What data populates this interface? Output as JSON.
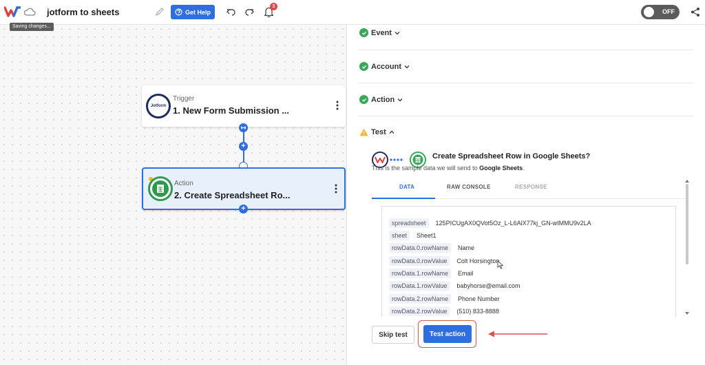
{
  "header": {
    "flow_title": "jotform to sheets",
    "saving_tooltip": "Saving changes...",
    "help_label": "Get Help",
    "notification_count": "3",
    "toggle_label": "OFF"
  },
  "canvas": {
    "trigger": {
      "subtitle": "Trigger",
      "title": "1. New Form Submission ...",
      "app_logo_text": "Jotform"
    },
    "action": {
      "subtitle": "Action",
      "title": "2. Create Spreadsheet Ro..."
    }
  },
  "panel": {
    "sections": {
      "event": "Event",
      "account": "Account",
      "action": "Action",
      "test": "Test"
    },
    "test_summary": {
      "title": "Create Spreadsheet Row in Google Sheets?",
      "desc_prefix": "This is the sample data we will send to",
      "desc_app": "Google Sheets",
      "desc_suffix": "."
    },
    "tabs": [
      "DATA",
      "RAW CONSOLE",
      "RESPONSE"
    ],
    "rows": [
      {
        "key": "spreadsheet",
        "value": "125PICUgAX0QVot5Oz_L-L6AlX77kj_GN-wIMMU9v2LA"
      },
      {
        "key": "sheet",
        "value": "Sheet1"
      },
      {
        "key": "rowData.0.rowName",
        "value": "Name"
      },
      {
        "key": "rowData.0.rowValue",
        "value": "Colt Horsington"
      },
      {
        "key": "rowData.1.rowName",
        "value": "Email"
      },
      {
        "key": "rowData.1.rowValue",
        "value": "babyhorse@email.com"
      },
      {
        "key": "rowData.2.rowName",
        "value": "Phone Number"
      },
      {
        "key": "rowData.2.rowValue",
        "value": "(510) 833-8888"
      }
    ],
    "skip_label": "Skip test",
    "test_label": "Test action"
  },
  "colors": {
    "accent": "#2f6ee0",
    "success": "#39a75a",
    "warning": "#f0b429",
    "highlight": "#d9534f"
  }
}
